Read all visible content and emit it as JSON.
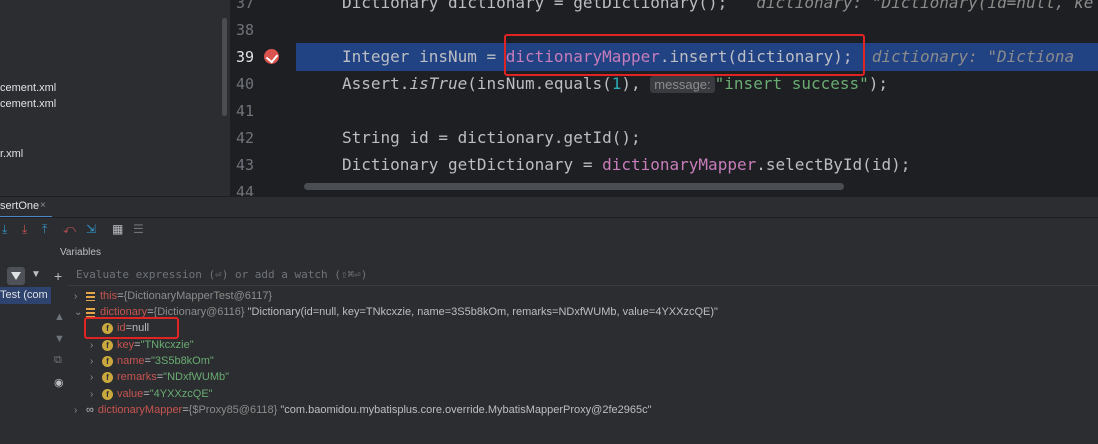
{
  "project_tree": {
    "files": [
      "cement.xml",
      "cement.xml",
      "r.xml"
    ]
  },
  "editor": {
    "line_numbers": [
      "37",
      "38",
      "39",
      "40",
      "41",
      "42",
      "43",
      "44"
    ],
    "lines": {
      "l37_code": "Dictionary dictionary = getDictionary();",
      "l37_inlay": "dictionary: \"Dictionary(id=null, ke",
      "l39_pre": "Integer insNum = ",
      "l39_var": "dictionaryMapper",
      "l39_post": ".insert(dictionary);",
      "l39_inlay": "dictionary: \"Dictiona",
      "l40_class": "Assert.",
      "l40_method": "isTrue",
      "l40_mid": "(insNum.equals(",
      "l40_num": "1",
      "l40_comma": "), ",
      "l40_hint": "message:",
      "l40_str": "\"insert success\"",
      "l40_end": ");",
      "l42_code": "String id = dictionary.getId();",
      "l43_pre": "Dictionary getDictionary = ",
      "l43_var": "dictionaryMapper",
      "l43_post": ".selectById(id);"
    },
    "breakpoint_color": "#d9534f",
    "highlight_color": "#214283"
  },
  "debug": {
    "tab_label": "sertOne",
    "tab_close": "×",
    "frame_label": "Test (com",
    "variables_title": "Variables",
    "eval_placeholder": "Evaluate expression (⏎) or add a watch (⇧⌘⏎)",
    "variables": [
      {
        "name": "this",
        "eq": " = ",
        "type": "{DictionaryMapperTest@6117}",
        "value": ""
      },
      {
        "name": "dictionary",
        "eq": " = ",
        "type": "{Dictionary@6116}",
        "value": "\"Dictionary(id=null, key=TNkcxzie, name=3S5b8kOm, remarks=NDxfWUMb, value=4YXXzcQE)\""
      },
      {
        "name": "id",
        "eq": " = ",
        "type": "",
        "value": "null"
      },
      {
        "name": "key",
        "eq": " = ",
        "type": "",
        "value": "\"TNkcxzie\""
      },
      {
        "name": "name",
        "eq": " = ",
        "type": "",
        "value": "\"3S5b8kOm\""
      },
      {
        "name": "remarks",
        "eq": " = ",
        "type": "",
        "value": "\"NDxfWUMb\""
      },
      {
        "name": "value",
        "eq": " = ",
        "type": "",
        "value": "\"4YXXzcQE\""
      },
      {
        "name": "dictionaryMapper",
        "eq": " = ",
        "type": "{$Proxy85@6118}",
        "value": "\"com.baomidou.mybatisplus.core.override.MybatisMapperProxy@2fe2965c\""
      }
    ],
    "annotation_color": "#e02424"
  }
}
